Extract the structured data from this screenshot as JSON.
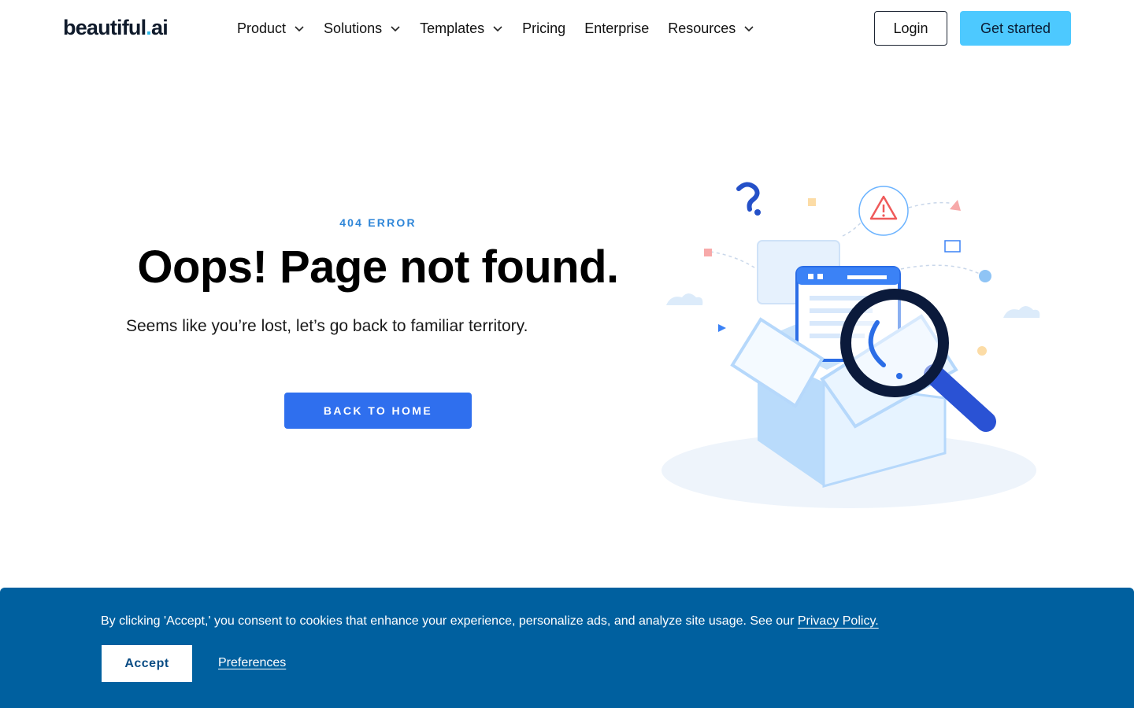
{
  "header": {
    "logo_main": "beautiful",
    "logo_dot": ".",
    "logo_suffix": "ai",
    "nav": [
      {
        "label": "Product",
        "has_dropdown": true
      },
      {
        "label": "Solutions",
        "has_dropdown": true
      },
      {
        "label": "Templates",
        "has_dropdown": true
      },
      {
        "label": "Pricing",
        "has_dropdown": false
      },
      {
        "label": "Enterprise",
        "has_dropdown": false
      },
      {
        "label": "Resources",
        "has_dropdown": true
      }
    ],
    "login_label": "Login",
    "get_started_label": "Get started"
  },
  "hero": {
    "eyebrow": "404 ERROR",
    "title": "Oops! Page not found.",
    "subtitle": "Seems like you’re lost, let’s go back to familiar territory.",
    "button_label": "BACK TO HOME"
  },
  "cookie": {
    "text": "By clicking 'Accept,' you consent to cookies that enhance your experience, personalize ads, and analyze site usage. See our ",
    "privacy_link": "Privacy Policy.",
    "accept_label": "Accept",
    "preferences_label": "Preferences"
  },
  "colors": {
    "accent": "#4dc9ff",
    "primary_button": "#2f6fee",
    "eyebrow": "#2f86d8",
    "banner": "#00609f"
  }
}
